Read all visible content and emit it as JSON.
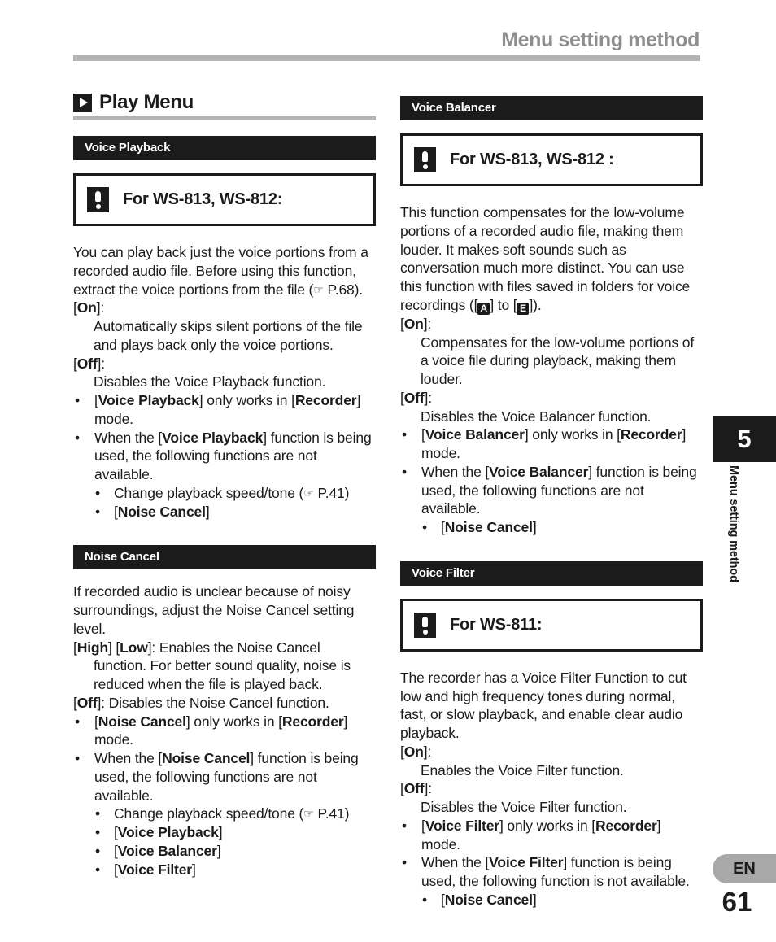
{
  "header": {
    "title": "Menu setting method"
  },
  "chapter": {
    "section_title": "Play Menu",
    "play_icon": "play-triangle-icon",
    "tab_number": "5",
    "tab_vertical_label": "Menu setting method",
    "language": "EN",
    "page_number": "61"
  },
  "left_column": {
    "voice_playback": {
      "bar_label": "Voice Playback",
      "notice": {
        "icon": "exclamation-icon",
        "text": "For WS-813, WS-812:"
      },
      "intro_1": "You can play back just the voice portions from a recorded audio file. Before using this function, extract the voice portions from the file (",
      "intro_ref": "P.68",
      "intro_2": ").",
      "on_label_open": "[",
      "on_label": "On",
      "on_label_close": "]:",
      "on_desc": "Automatically skips silent portions of the file and plays back only the voice portions.",
      "off_label": "Off",
      "off_desc": "Disables the Voice Playback function.",
      "bullet_1_pre": "[",
      "bullet_1_b1": "Voice Playback",
      "bullet_1_mid": "] only works in [",
      "bullet_1_b2": "Recorder",
      "bullet_1_post": "] mode.",
      "bullet_2_pre": "When the [",
      "bullet_2_b1": "Voice Playback",
      "bullet_2_post": "] function is being used, the following functions are not available.",
      "sub_1_text": "Change playback speed/tone (",
      "sub_1_ref": "P.41",
      "sub_1_post": ")",
      "sub_2_pre": "[",
      "sub_2_b": "Noise Cancel",
      "sub_2_post": "]"
    },
    "noise_cancel": {
      "bar_label": "Noise Cancel",
      "intro": "If recorded audio is unclear because of noisy surroundings, adjust the Noise Cancel setting level.",
      "high_low_pre": "[",
      "high_label": "High",
      "high_low_mid": "] [",
      "low_label": "Low",
      "high_low_post": "]: Enables the Noise Cancel",
      "high_low_desc": "function. For better sound quality, noise is reduced when the file is played back.",
      "off_label": "Off",
      "off_post": "]: Disables the Noise Cancel function.",
      "bullet_1_pre": "[",
      "bullet_1_b1": "Noise Cancel",
      "bullet_1_mid": "] only works in [",
      "bullet_1_b2": "Recorder",
      "bullet_1_post": "] mode.",
      "bullet_2_pre": "When the [",
      "bullet_2_b1": "Noise Cancel",
      "bullet_2_post": "] function is being used, the following functions are not available.",
      "sub_1_text": "Change playback speed/tone (",
      "sub_1_ref": "P.41",
      "sub_1_post": ")",
      "sub_2_b": "Voice Playback",
      "sub_3_b": "Voice Balancer",
      "sub_4_b": "Voice Filter"
    }
  },
  "right_column": {
    "voice_balancer": {
      "bar_label": "Voice Balancer",
      "notice": {
        "icon": "exclamation-icon",
        "text": "For WS-813, WS-812 :"
      },
      "intro_1": "This function compensates for the low-volume portions of a recorded audio file, making them louder. It makes soft sounds such as conversation much more distinct. You can use this function with files saved in folders for voice recordings ([",
      "folder_from": "A",
      "intro_mid": "] to [",
      "folder_to": "E",
      "intro_2": "]).",
      "on_label": "On",
      "on_desc": "Compensates for the low-volume portions of a voice file during playback, making them louder.",
      "off_label": "Off",
      "off_desc": "Disables the Voice Balancer function.",
      "bullet_1_pre": "[",
      "bullet_1_b1": "Voice Balancer",
      "bullet_1_mid": "] only works in [",
      "bullet_1_b2": "Recorder",
      "bullet_1_post": "] mode.",
      "bullet_2_pre": "When the [",
      "bullet_2_b1": "Voice Balancer",
      "bullet_2_post": "] function is being used, the following functions are not available.",
      "sub_1_pre": "[",
      "sub_1_b": "Noise Cancel",
      "sub_1_post": "]"
    },
    "voice_filter": {
      "bar_label": "Voice Filter",
      "notice": {
        "icon": "exclamation-icon",
        "text": "For WS-811:"
      },
      "intro": "The recorder has a Voice Filter Function to cut low and high frequency tones during normal, fast, or slow playback, and enable clear audio playback.",
      "on_label": "On",
      "on_desc": "Enables the Voice Filter function.",
      "off_label": "Off",
      "off_desc": "Disables the Voice Filter function.",
      "bullet_1_pre": "[",
      "bullet_1_b1": "Voice Filter",
      "bullet_1_mid": "] only works in [",
      "bullet_1_b2": "Recorder",
      "bullet_1_post": "] mode.",
      "bullet_2_pre": "When the [",
      "bullet_2_b1": "Voice Filter",
      "bullet_2_post": "] function is being used, the following function is not available.",
      "sub_1_pre": "[",
      "sub_1_b": "Noise Cancel",
      "sub_1_post": "]"
    }
  },
  "symbols": {
    "bullet": "•",
    "sub_bullet": "•",
    "hand": "☞"
  }
}
